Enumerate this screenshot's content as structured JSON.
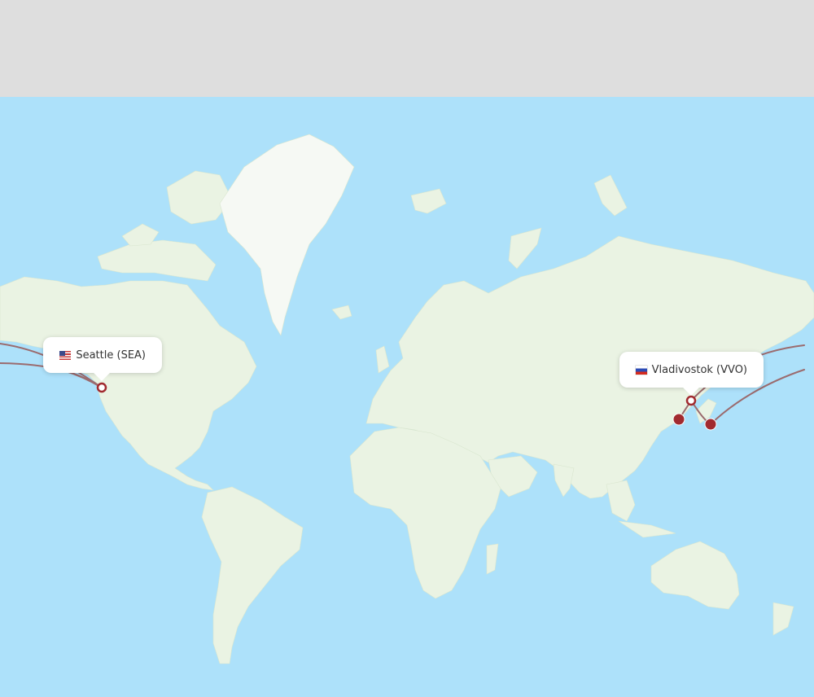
{
  "colors": {
    "ocean": "#ade1fa",
    "land": "#eaf3e3",
    "ice": "#f6f9f4",
    "route": "#9b6b6e",
    "airport_dot": "#a12a2f",
    "header": "#dedede"
  },
  "origin": {
    "city": "Seattle",
    "code": "SEA",
    "label": "Seattle (SEA)",
    "flag": "us-flag-icon"
  },
  "destination": {
    "city": "Vladivostok",
    "code": "VVO",
    "label": "Vladivostok (VVO)",
    "flag": "ru-flag-icon"
  }
}
